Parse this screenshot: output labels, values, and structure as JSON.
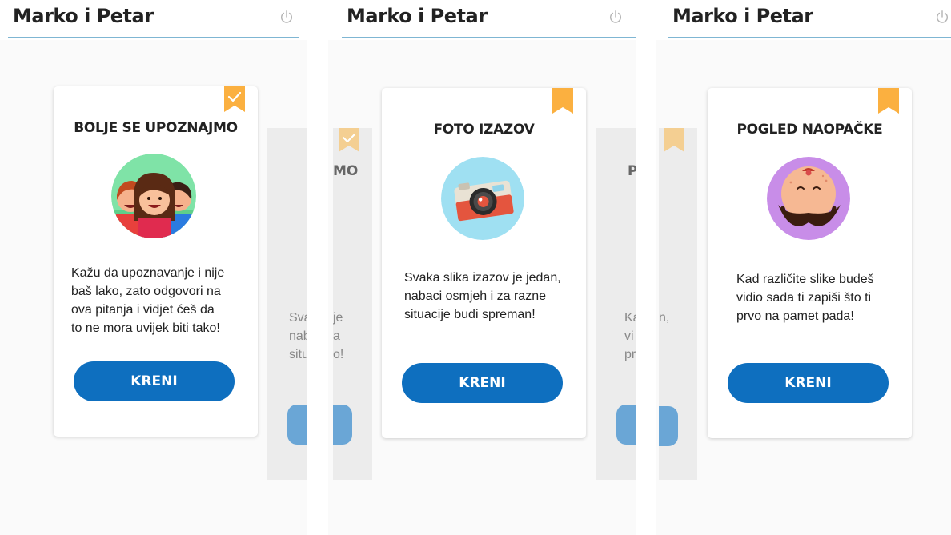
{
  "app": {
    "title": "Marko i Petar"
  },
  "colors": {
    "accent_blue": "#0e6fbf",
    "header_line": "#7fb6d3",
    "bookmark_orange": "#fbb040",
    "bookmark_faded": "#f4cf92"
  },
  "icons": {
    "power": "power-icon",
    "bookmark": "bookmark-icon",
    "check": "check-icon"
  },
  "screens": [
    {
      "card": {
        "heading": "BOLJE SE UPOZNAJMO",
        "description_lines": [
          "Kažu da upoznavanje i nije",
          "baš lako, zato odgovori na",
          "ova pitanja i vidjet ćeš da",
          "to ne mora uvijek biti tako!"
        ],
        "button": "KRENI",
        "completed": true
      },
      "peek": {
        "heading_fragment": "MO",
        "text_left": [
          "Sva",
          "nab",
          "situ"
        ],
        "text_right": [
          "je",
          "a",
          "",
          "o!"
        ]
      }
    },
    {
      "card": {
        "heading": "FOTO IZAZOV",
        "description_lines": [
          "Svaka slika izazov je jedan,",
          "nabaci osmjeh i za razne",
          "situacije budi spreman!"
        ],
        "button": "KRENI",
        "completed": false
      },
      "peek": {
        "heading_fragment": "P",
        "text_left": [
          "Ka",
          "vi",
          "pr"
        ],
        "text_right": [
          "n,"
        ]
      }
    },
    {
      "card": {
        "heading": "POGLED NAOPAČKE",
        "description_lines": [
          "Kad različite slike budeš",
          "vidio sada ti zapiši što ti",
          "prvo na pamet pada!"
        ],
        "button": "KRENI",
        "completed": false
      }
    }
  ]
}
